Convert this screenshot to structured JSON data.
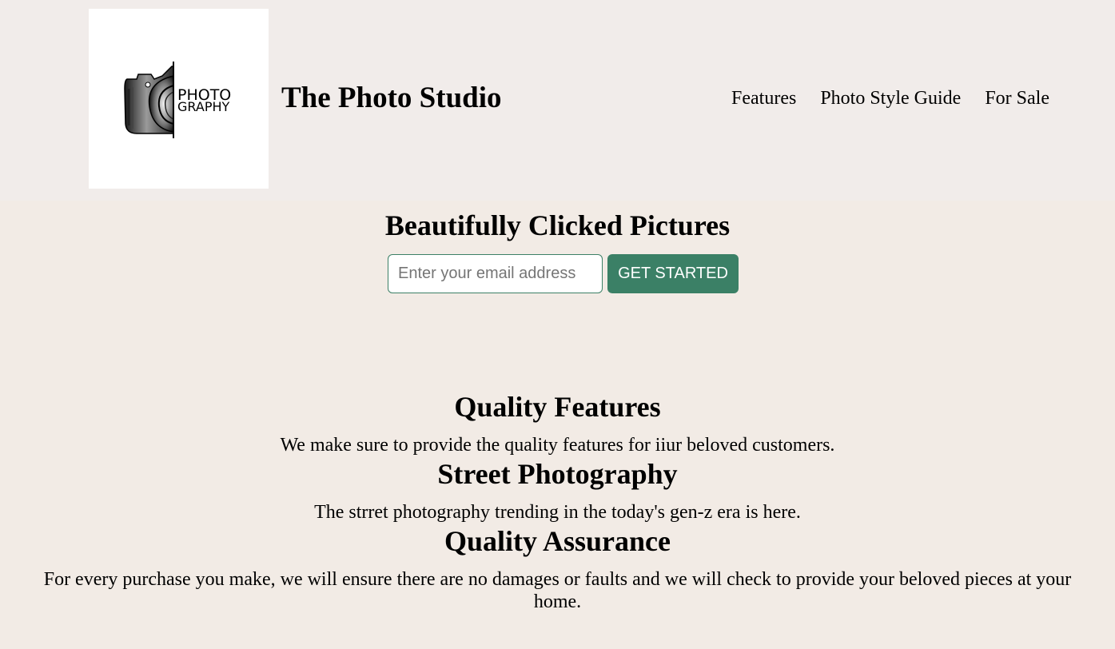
{
  "header": {
    "logo": {
      "line1": "PHOTO",
      "line2": "GRAPHY"
    },
    "title": "The Photo Studio",
    "nav": [
      {
        "label": "Features"
      },
      {
        "label": "Photo Style Guide"
      },
      {
        "label": "For Sale"
      }
    ]
  },
  "hero": {
    "title": "Beautifully Clicked Pictures",
    "email_placeholder": "Enter your email address",
    "email_value": "",
    "cta_label": "GET STARTED"
  },
  "features": [
    {
      "heading": "Quality Features",
      "text": "We make sure to provide the quality features for iiur beloved customers."
    },
    {
      "heading": "Street Photography",
      "text": "The strret photography trending in the today's gen-z era is here."
    },
    {
      "heading": "Quality Assurance",
      "text": "For every purchase you make, we will ensure there are no damages or faults and we will check to provide your beloved pieces at your home."
    }
  ],
  "colors": {
    "page_background": "#f2ebe5",
    "header_background": "#f1ecea",
    "accent": "#3b8066",
    "button_text": "#ffffff"
  }
}
